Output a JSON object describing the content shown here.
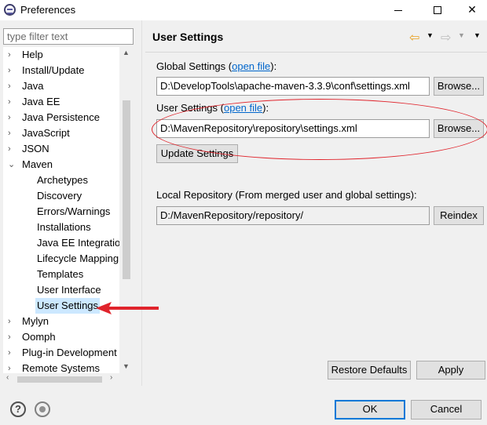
{
  "window": {
    "title": "Preferences",
    "minimize_glyph": "",
    "maximize_glyph": "",
    "close_glyph": "✕"
  },
  "filter": {
    "placeholder": "type filter text",
    "value": ""
  },
  "tree": {
    "items": [
      {
        "label": "Help",
        "arrow": "›"
      },
      {
        "label": "Install/Update",
        "arrow": "›"
      },
      {
        "label": "Java",
        "arrow": "›"
      },
      {
        "label": "Java EE",
        "arrow": "›"
      },
      {
        "label": "Java Persistence",
        "arrow": "›"
      },
      {
        "label": "JavaScript",
        "arrow": "›"
      },
      {
        "label": "JSON",
        "arrow": "›"
      },
      {
        "label": "Maven",
        "arrow": "⌄"
      },
      {
        "label": "Archetypes"
      },
      {
        "label": "Discovery"
      },
      {
        "label": "Errors/Warnings"
      },
      {
        "label": "Installations"
      },
      {
        "label": "Java EE Integration"
      },
      {
        "label": "Lifecycle Mapping"
      },
      {
        "label": "Templates"
      },
      {
        "label": "User Interface"
      },
      {
        "label": "User Settings"
      },
      {
        "label": "Mylyn",
        "arrow": "›"
      },
      {
        "label": "Oomph",
        "arrow": "›"
      },
      {
        "label": "Plug-in Development",
        "arrow": "›"
      },
      {
        "label": "Remote Systems",
        "arrow": "›"
      }
    ]
  },
  "page": {
    "title": "User Settings",
    "global_label_prefix": "Global Settings (",
    "global_link": "open file",
    "global_label_suffix": "):",
    "global_path": "D:\\DevelopTools\\apache-maven-3.3.9\\conf\\settings.xml",
    "browse_label": "Browse...",
    "user_label_prefix": "User Settings (",
    "user_link": "open file",
    "user_label_suffix": "):",
    "user_path": "D:\\MavenRepository\\repository\\settings.xml",
    "update_label": "Update Settings",
    "local_repo_label": "Local Repository (From merged user and global settings):",
    "local_repo_path": "D:/MavenRepository/repository/",
    "reindex_label": "Reindex",
    "restore_defaults_label": "Restore Defaults",
    "apply_label": "Apply"
  },
  "footer": {
    "ok_label": "OK",
    "cancel_label": "Cancel",
    "help_glyph": "?"
  },
  "colors": {
    "annotation_red": "#e0242c",
    "selection": "#cce8ff",
    "link": "#0066cc"
  }
}
